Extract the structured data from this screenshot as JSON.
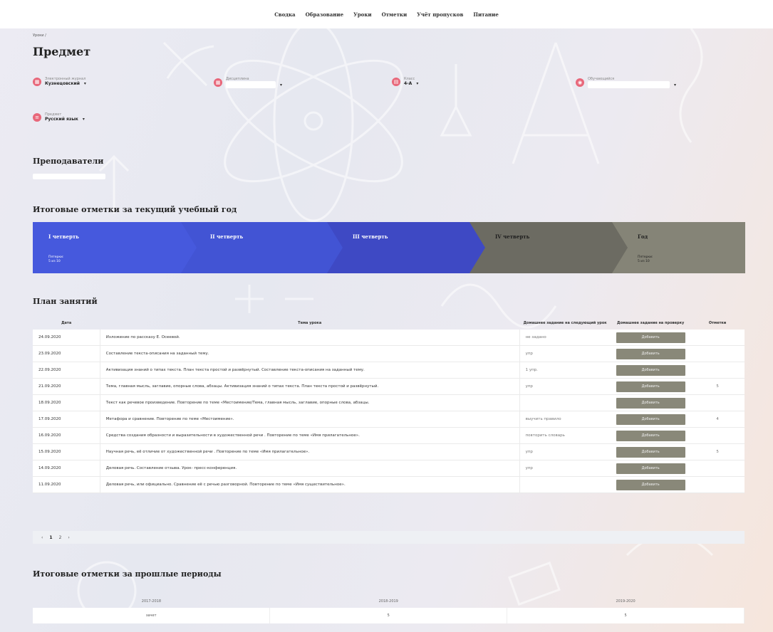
{
  "nav": [
    "Сводка",
    "Образование",
    "Уроки",
    "Отметки",
    "Учёт пропусков",
    "Питание"
  ],
  "breadcrumb": "Уроки /",
  "page_title": "Предмет",
  "filters": [
    {
      "label": "Электронный журнал",
      "value": "Кузнецовский"
    },
    {
      "label": "Дисциплина",
      "value": ""
    },
    {
      "label": "Класс",
      "value": "4-А"
    },
    {
      "label": "Обучающийся",
      "value": ""
    },
    {
      "label": "Предмет",
      "value": "Русский язык"
    }
  ],
  "teachers_heading": "Преподаватели",
  "grades_heading": "Итоговые отметки за текущий учебный год",
  "grade_periods": [
    {
      "title": "I четверть",
      "sub1": "Пятерки:",
      "sub2": "5 из 10",
      "color": "#4659dd"
    },
    {
      "title": "II четверть",
      "sub1": "",
      "sub2": "",
      "color": "#4254d4"
    },
    {
      "title": "III четверть",
      "sub1": "",
      "sub2": "",
      "color": "#3e49c4"
    },
    {
      "title": "IV четверть",
      "sub1": "",
      "sub2": "",
      "color": "#6c6b62"
    },
    {
      "title": "Год",
      "sub1": "Пятерки:",
      "sub2": "5 из 10",
      "color": "#858477"
    }
  ],
  "plan_heading": "План занятий",
  "table_headers": [
    "Дата",
    "Тема урока",
    "Домашнее задание на следующий урок",
    "Домашнее задание на проверку",
    "Отметки"
  ],
  "add_label": "Добавить",
  "lessons": [
    {
      "date": "24.09.2020",
      "topic": "Изложение по рассказу Е. Осеевой.",
      "hw": "не задано",
      "mark": ""
    },
    {
      "date": "23.09.2020",
      "topic": "Составление текста-описания на заданный тему.",
      "hw": "упр",
      "mark": ""
    },
    {
      "date": "22.09.2020",
      "topic": "Активизация знаний о типах текста. План текста простой и развёрнутый. Составление текста-описания на заданный тему.",
      "hw": "1 упр.",
      "mark": ""
    },
    {
      "date": "21.09.2020",
      "topic": "Тема, главная мысль, заглавие, опорные слова, абзацы. Активизация знаний о типах текста. План текста простой и развёрнутый.",
      "hw": "упр",
      "mark": "5"
    },
    {
      "date": "18.09.2020",
      "topic": "Текст как речевое произведение. Повторение по теме «Местоимение/Тема, главная мысль, заглавие, опорные слова, абзацы.",
      "hw": "",
      "mark": ""
    },
    {
      "date": "17.09.2020",
      "topic": "Метафора и сравнение. Повторение по теме «Местоимение».",
      "hw": "выучить правило",
      "mark": "4"
    },
    {
      "date": "16.09.2020",
      "topic": "Средства создания образности и выразительности в художественной речи . Повторение по теме «Имя прилагательное».",
      "hw": "повторить словарь",
      "mark": ""
    },
    {
      "date": "15.09.2020",
      "topic": "Научная речь, её отличие от художественной речи . Повторение по теме «Имя прилагательное».",
      "hw": "упр",
      "mark": "5"
    },
    {
      "date": "14.09.2020",
      "topic": "Деловая речь. Составление отзыва. Урок- пресс-конференция.",
      "hw": "упр",
      "mark": ""
    },
    {
      "date": "11.09.2020",
      "topic": "Деловая речь, или официально. Сравнение её с речью разговорной. Повторение по теме «Имя существительное».",
      "hw": "",
      "mark": ""
    }
  ],
  "pagination": [
    "‹",
    "1",
    "2",
    "›"
  ],
  "past_heading": "Итоговые отметки за прошлые периоды",
  "past_years": [
    "2017-2018",
    "2018-2019",
    "2019-2020"
  ],
  "past_values": [
    "зачет",
    "5",
    "5"
  ]
}
